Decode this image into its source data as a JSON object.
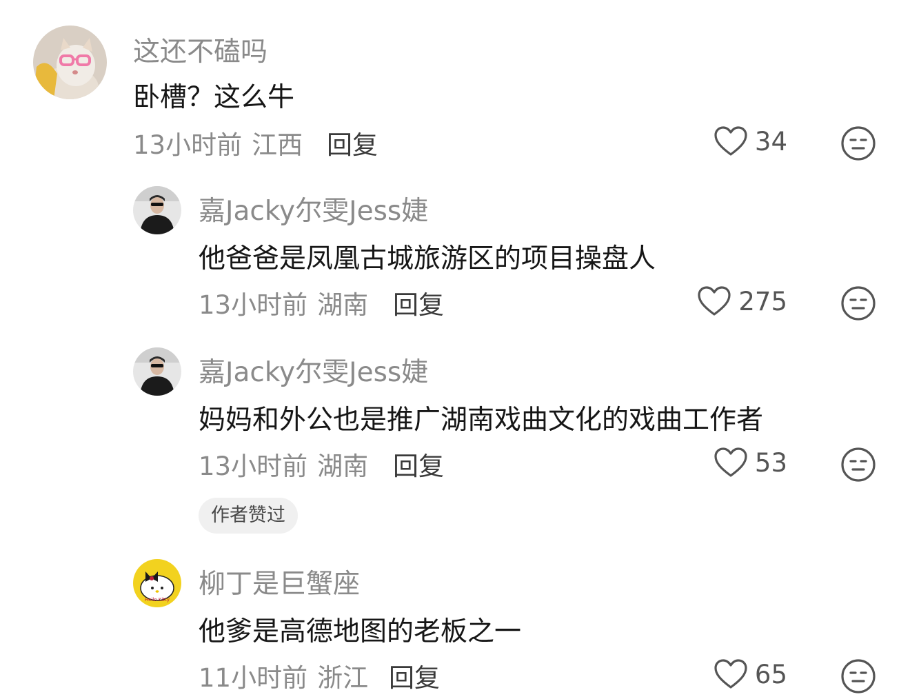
{
  "comments": [
    {
      "username": "这还不磕吗",
      "text": "卧槽？这么牛",
      "time": "13小时前",
      "location": "江西",
      "reply_label": "回复",
      "likes": "34"
    },
    {
      "username": "嘉Jacky尔雯Jess婕",
      "text": "他爸爸是凤凰古城旅游区的项目操盘人",
      "time": "13小时前",
      "location": "湖南",
      "reply_label": "回复",
      "likes": "275"
    },
    {
      "username": "嘉Jacky尔雯Jess婕",
      "text": "妈妈和外公也是推广湖南戏曲文化的戏曲工作者",
      "time": "13小时前",
      "location": "湖南",
      "reply_label": "回复",
      "likes": "53",
      "badge": "作者赞过"
    },
    {
      "username": "柳丁是巨蟹座",
      "text": "他爹是高德地图的老板之一",
      "time": "11小时前",
      "location": "浙江",
      "reply_label": "回复",
      "likes": "65",
      "avatar_text": "Hello Kitty"
    }
  ],
  "icons": {
    "like": "heart-outline-icon",
    "dislike": "neutral-face-icon"
  },
  "colors": {
    "username": "#8a8a8a",
    "text": "#161616",
    "badge_bg": "#f0f0f0"
  }
}
